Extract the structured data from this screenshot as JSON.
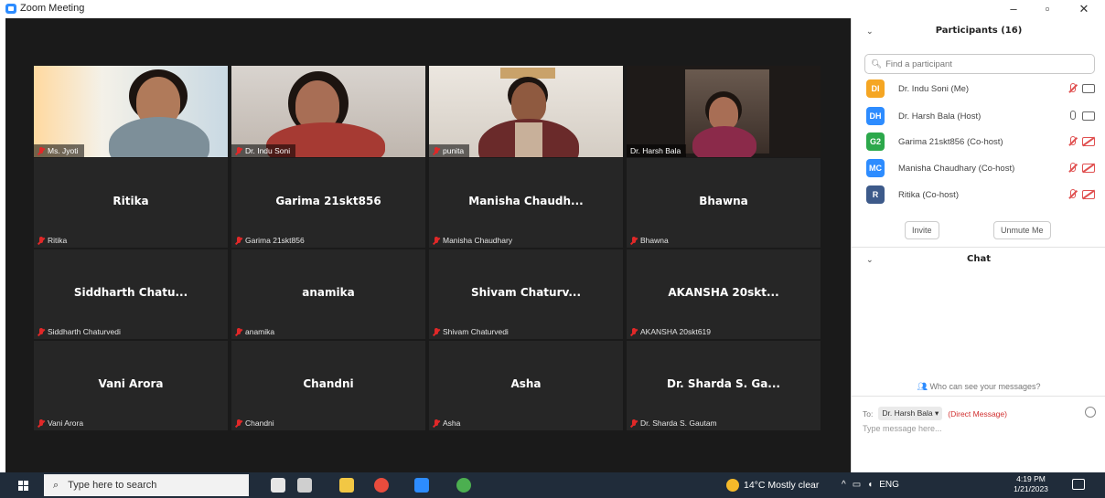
{
  "window": {
    "title": "Zoom Meeting",
    "controls": [
      "–",
      "▫",
      "✕"
    ]
  },
  "video_tiles": [
    {
      "name": "Ms. Jyoti",
      "muted": true,
      "bg": "#8a8a7a",
      "skin": "#b07a5a",
      "shirt": "#7d8f99",
      "wall": "#ffdca0"
    },
    {
      "name": "Dr. Indu Soni",
      "muted": true,
      "bg": "#b9b0a8",
      "skin": "#a86e55",
      "shirt": "#a63a33",
      "wall": "#d6d0cb"
    },
    {
      "name": "punita",
      "muted": true,
      "bg": "#c9c4bd",
      "skin": "#8f5a40",
      "shirt": "#6a2a2a",
      "wall": "#e9e4dd"
    },
    {
      "name": "Dr. Harsh Bala",
      "muted": false,
      "bg": "#1e1a18",
      "skin": "#a86e55",
      "shirt": "#8b2a4a",
      "wall": "#6a5a4f",
      "highlight": true
    }
  ],
  "name_tiles": [
    {
      "big": "Ritika",
      "label": "Ritika"
    },
    {
      "big": "Garima 21skt856",
      "label": "Garima 21skt856"
    },
    {
      "big": "Manisha Chaudh...",
      "label": "Manisha Chaudhary"
    },
    {
      "big": "Bhawna",
      "label": "Bhawna"
    },
    {
      "big": "Siddharth Chatu...",
      "label": "Siddharth Chaturvedi"
    },
    {
      "big": "anamika",
      "label": "anamika"
    },
    {
      "big": "Shivam Chaturv...",
      "label": "Shivam Chaturvedi"
    },
    {
      "big": "AKANSHA 20skt...",
      "label": "AKANSHA 20skt619"
    },
    {
      "big": "Vani Arora",
      "label": "Vani Arora"
    },
    {
      "big": "Chandni",
      "label": "Chandni"
    },
    {
      "big": "Asha",
      "label": "Asha"
    },
    {
      "big": "Dr. Sharda S. Ga...",
      "label": "Dr. Sharda S. Gautam"
    }
  ],
  "participants_panel": {
    "title": "Participants (16)",
    "search_placeholder": "Find a participant",
    "list": [
      {
        "initials": "DI",
        "name": "Dr. Indu Soni (Me)",
        "color": "#f5a623",
        "mic": "off",
        "cam": "on"
      },
      {
        "initials": "DH",
        "name": "Dr. Harsh Bala (Host)",
        "color": "#2d8cff",
        "mic": "on",
        "cam": "on"
      },
      {
        "initials": "G2",
        "name": "Garima 21skt856 (Co-host)",
        "color": "#2ca84b",
        "mic": "off",
        "cam": "off"
      },
      {
        "initials": "MC",
        "name": "Manisha Chaudhary (Co-host)",
        "color": "#2d8cff",
        "mic": "off",
        "cam": "off"
      },
      {
        "initials": "R",
        "name": "Ritika (Co-host)",
        "color": "#3d5a8a",
        "mic": "off",
        "cam": "off"
      }
    ],
    "invite_label": "Invite",
    "unmute_label": "Unmute Me"
  },
  "chat_panel": {
    "title": "Chat",
    "who_can_see": "Who can see your messages?",
    "to_label": "To:",
    "recipient": "Dr. Harsh Bala ▾",
    "direct": "(Direct Message)",
    "placeholder": "Type message here..."
  },
  "taskbar": {
    "search_placeholder": "Type here to search",
    "weather": "14°C  Mostly clear",
    "lang": "ENG",
    "time": "4:19 PM",
    "date": "1/21/2023"
  }
}
